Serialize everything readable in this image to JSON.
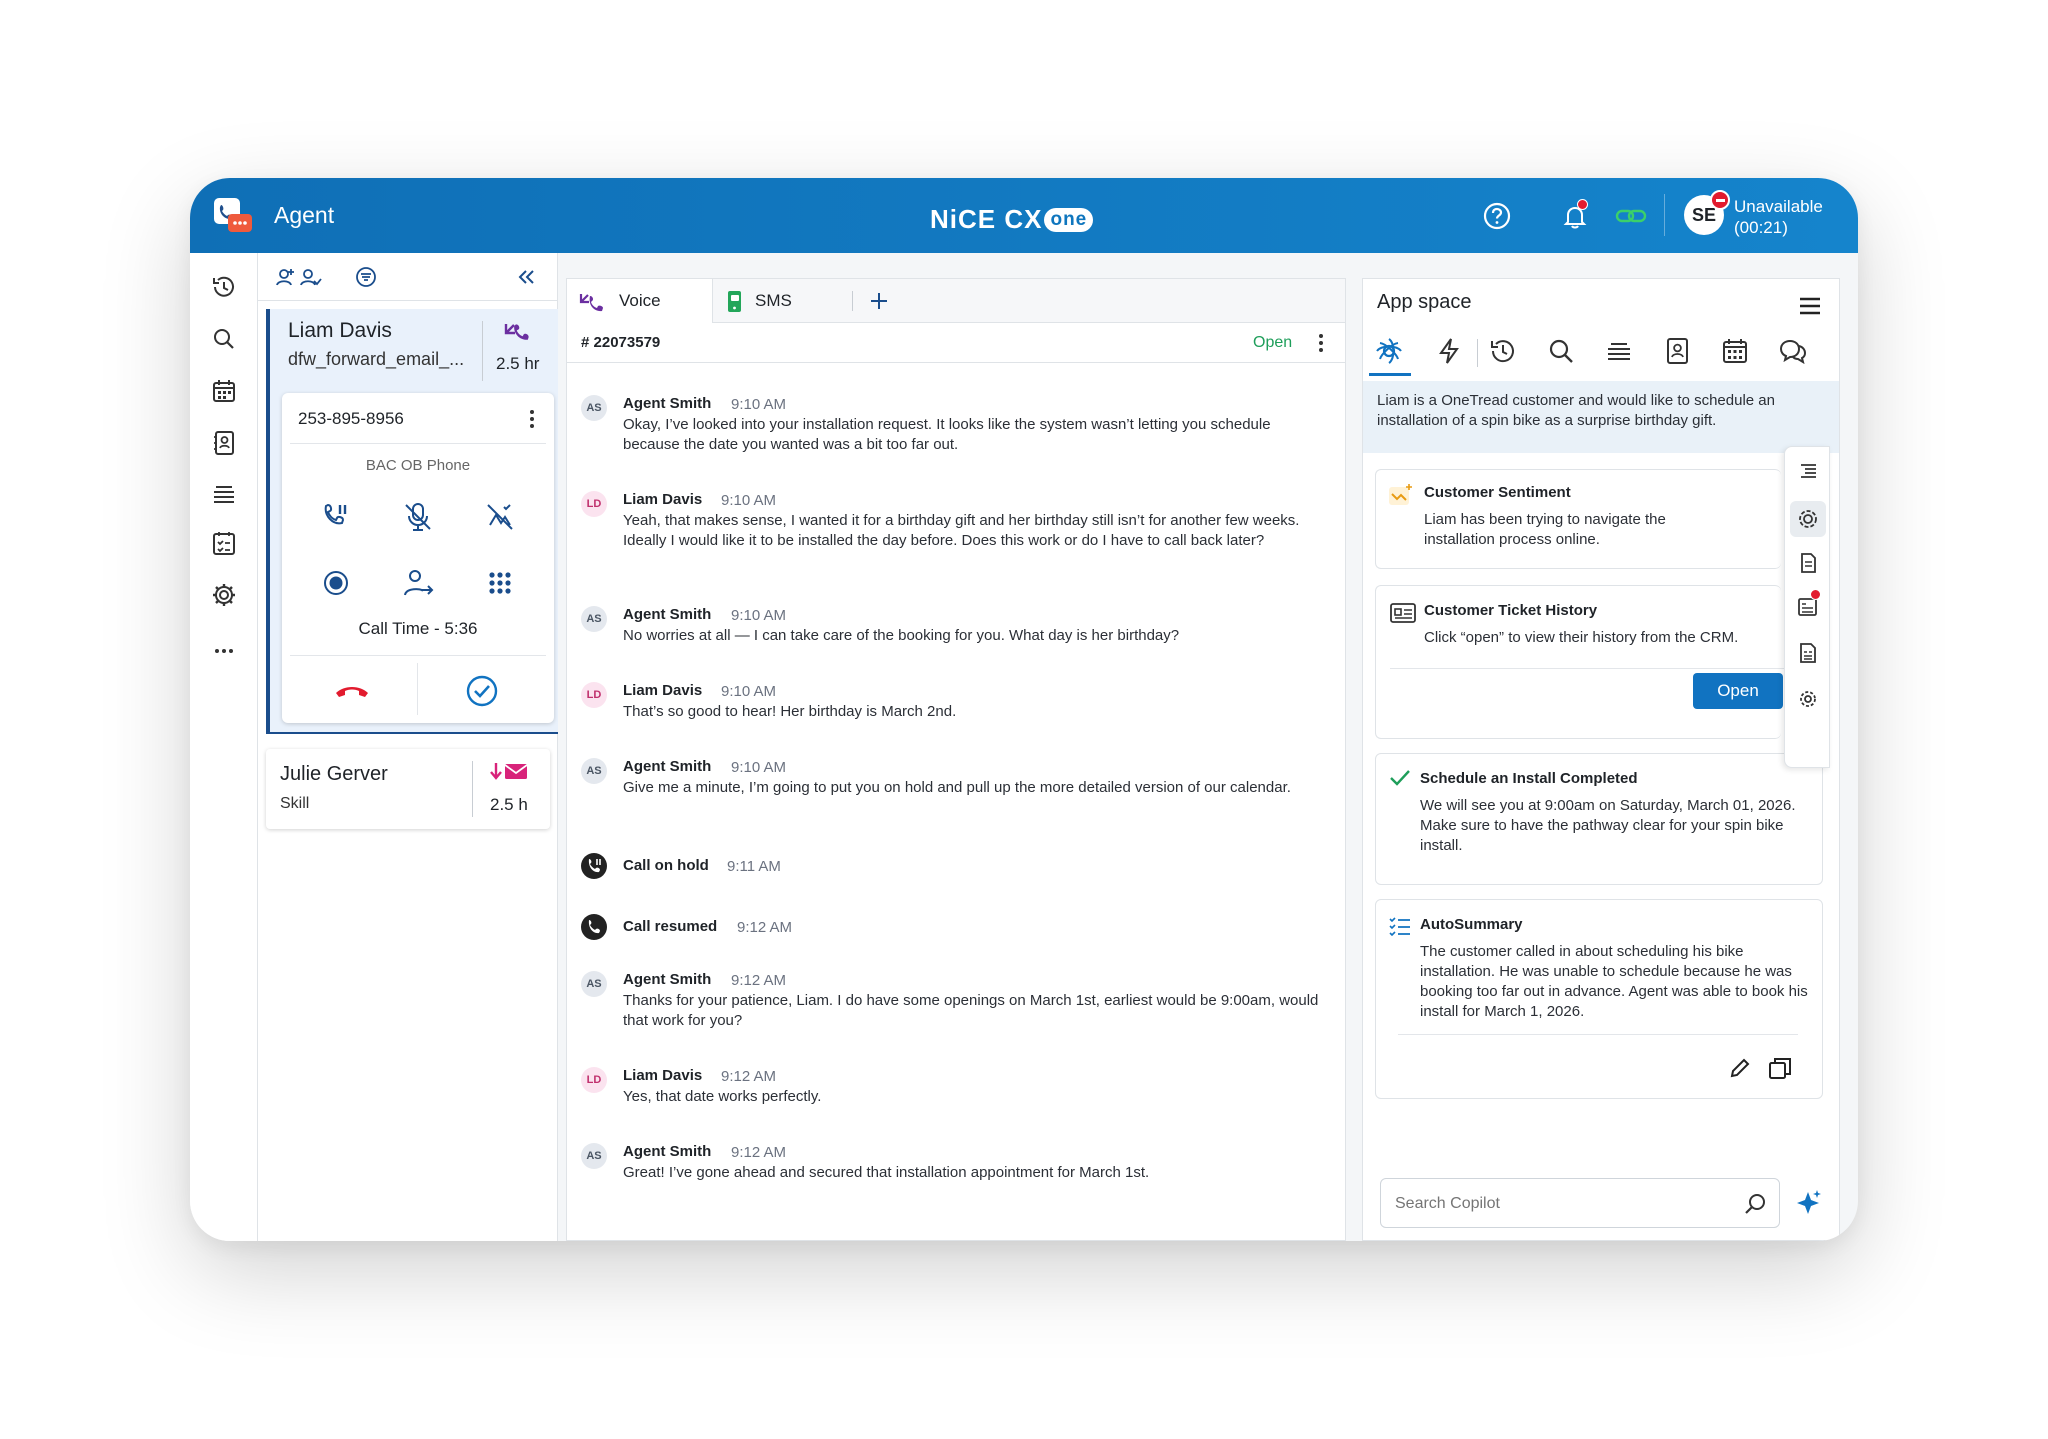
{
  "header": {
    "app_name": "Agent",
    "logo_text": "NiCE CX",
    "logo_suffix": "one",
    "user_initials": "SE",
    "status_label": "Unavailable",
    "status_timer": "(00:21)"
  },
  "queue": {
    "active_contact": {
      "name": "Liam Davis",
      "skill": "dfw_forward_email_...",
      "duration": "2.5 hr",
      "phone": "253-895-8956",
      "line_label": "BAC OB Phone",
      "call_time": "Call Time - 5:36"
    },
    "second_contact": {
      "name": "Julie Gerver",
      "skill": "Skill",
      "duration": "2.5 h"
    }
  },
  "chat": {
    "tabs": [
      "Voice",
      "SMS"
    ],
    "ticket_id": "# 22073579",
    "ticket_status": "Open",
    "messages": [
      {
        "initials": "AS",
        "name": "Agent Smith",
        "time": "9:10 AM",
        "text": "Okay, I’ve looked into your installation request. It looks like the system wasn’t letting you schedule because the date you wanted was a bit too far out."
      },
      {
        "initials": "LD",
        "name": "Liam Davis",
        "time": "9:10 AM",
        "text": "Yeah, that makes sense, I wanted it for a birthday gift and her birthday still isn’t for another few weeks. Ideally I would like it to be installed the day before. Does this work or do I have to call back later?"
      },
      {
        "initials": "AS",
        "name": "Agent Smith",
        "time": "9:10 AM",
        "text": "No worries at all — I can take care of the booking for you. What day is her birthday?"
      },
      {
        "initials": "LD",
        "name": "Liam Davis",
        "time": "9:10 AM",
        "text": "That’s so good to hear! Her birthday is March 2nd."
      },
      {
        "initials": "AS",
        "name": "Agent Smith",
        "time": "9:10 AM",
        "text": "Give me a minute, I’m going to put you on hold and pull up the more detailed version of our calendar."
      },
      {
        "initials": "AS",
        "name": "Agent Smith",
        "time": "9:12 AM",
        "text": "Thanks for your patience, Liam. I do have some openings on March 1st, earliest would be 9:00am, would that work for you?"
      },
      {
        "initials": "LD",
        "name": "Liam Davis",
        "time": "9:12 AM",
        "text": "Yes, that date works perfectly."
      },
      {
        "initials": "AS",
        "name": "Agent Smith",
        "time": "9:12 AM",
        "text": "Great! I’ve gone ahead and secured that installation appointment for March 1st."
      }
    ],
    "events": [
      {
        "label": "Call on hold",
        "time": "9:11 AM"
      },
      {
        "label": "Call resumed",
        "time": "9:12 AM"
      }
    ]
  },
  "app_space": {
    "title": "App space",
    "banner": "Liam is a OneTread customer and would like to schedule an installation of a spin bike as a surprise birthday gift.",
    "sentiment": {
      "title": "Customer Sentiment",
      "text": "Liam has been trying to navigate the installation process online."
    },
    "ticket_history": {
      "title": "Customer Ticket History",
      "text": "Click “open” to view their history from the CRM.",
      "button": "Open"
    },
    "install": {
      "title": "Schedule an Install Completed",
      "text": "We will see you at 9:00am on Saturday, March 01, 2026. Make sure to have the pathway clear for your spin bike install."
    },
    "summary": {
      "title": "AutoSummary",
      "text": "The customer called in about scheduling his bike installation. He was unable to schedule because he was booking too far out in advance. Agent was able to book his install for March 1, 2026."
    },
    "search_placeholder": "Search Copilot"
  },
  "colors": {
    "brand_blue": "#1173c1",
    "alert_red": "#e21b2e",
    "open_green": "#1e9e5a",
    "call_purple": "#6b2fa0"
  }
}
